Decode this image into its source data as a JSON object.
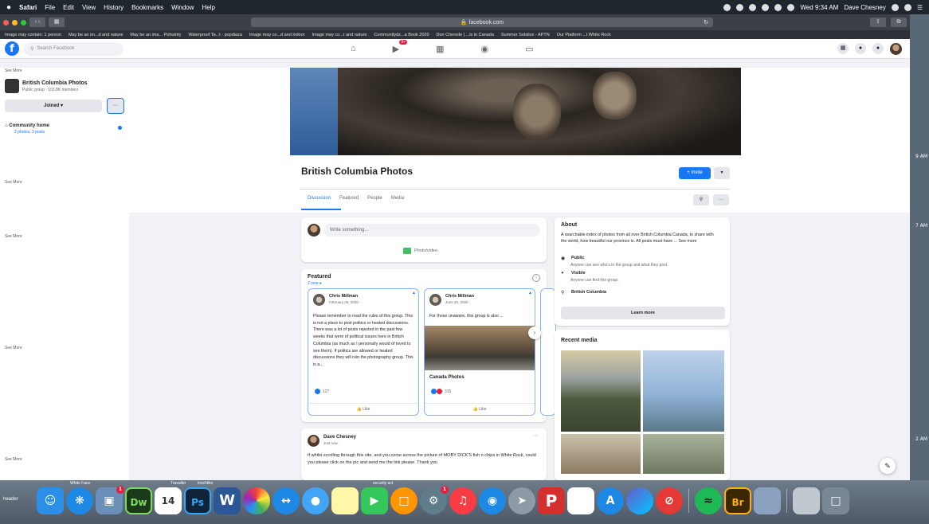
{
  "menubar": {
    "apple": "",
    "items": [
      "Safari",
      "File",
      "Edit",
      "View",
      "History",
      "Bookmarks",
      "Window",
      "Help"
    ],
    "clock": "Wed 9:34 AM",
    "user": "Dave Chesney"
  },
  "browser": {
    "url": "facebook.com",
    "bookmarks": [
      "Image may contain: 1 person",
      "May be an im...d and nature",
      "May be an ima... Pohutnty",
      "Waterproof Ta...t - popdiaza",
      "Image may co...d and indoor",
      "Image may co...r and nature",
      "Communitydz...a Book 2020",
      "Don Cherede | ...ls in Canada",
      "Summer Solstice - APTN",
      "Our Platform ...l White Rock"
    ]
  },
  "fb": {
    "logo": "f",
    "search_placeholder": "Search Facebook",
    "nav_badge": "9+"
  },
  "sidebar": {
    "see_more": "See More",
    "group_name": "British Columbia Photos",
    "group_meta": "Public group · 103.8K members",
    "joined": "Joined ▾",
    "more": "···",
    "community_home": "Community home",
    "community_sub": "2 photos, 3 posts"
  },
  "edge_labels": [
    "See More",
    "See More",
    "See More",
    "See More"
  ],
  "group": {
    "title": "British Columbia Photos",
    "invite": "+ Invite",
    "tabs": [
      "Discussion",
      "Featured",
      "People",
      "Media"
    ]
  },
  "composer": {
    "placeholder": "Write something...",
    "photo_video": "Photo/video"
  },
  "featured": {
    "title": "Featured",
    "new": "2 new ●",
    "cards": [
      {
        "name": "Chris Millman",
        "date": "February 26, 2020 · ",
        "text": "Please remember to read the rules of this group. This is not a place to post politics or heated discussions. There was a lot of posts rejected in the past few weeks that were of political issues here in British Columbia (as much as I personally would of loved to see them). If politics are allowed or heated discussions they will ruin the photography group. This is a...",
        "reactions": "127",
        "like": "Like"
      },
      {
        "name": "Chris Millman",
        "date": "June 20, 2020 · ",
        "text": "For those unaware, this group is also ...",
        "caption": "Canada Photos",
        "reactions": "315",
        "like": "Like"
      }
    ]
  },
  "post": {
    "author": "Dave Chesney",
    "time": "Just now · ",
    "text": "If whilst scrolling through this site, and you come across the picture of MOBY DICK'S fish n chips in White Rock, could you please click on the pic and send me the link please.  Thank you"
  },
  "about": {
    "title": "About",
    "text": "A searchable index of photos from all over British Columbia Canada, to share with the world, how beautiful our province is. All posts must have ... See more",
    "public_label": "Public",
    "public_sub": "Anyone can see who's in the group and what they post.",
    "visible_label": "Visible",
    "visible_sub": "Anyone can find this group.",
    "location": "British Columbia",
    "learn_more": "Learn more"
  },
  "recent_media": {
    "title": "Recent media"
  },
  "desktop_right": [
    "9 AM",
    "7 AM",
    "2 AM"
  ],
  "dock": {
    "header_label": "header",
    "labels": [
      "White Face",
      "Travaller",
      "Inschlike",
      "security act"
    ],
    "calendar_day": "14",
    "ps": "Ps",
    "dw": "Dw",
    "br": "Br",
    "notif": "1"
  }
}
